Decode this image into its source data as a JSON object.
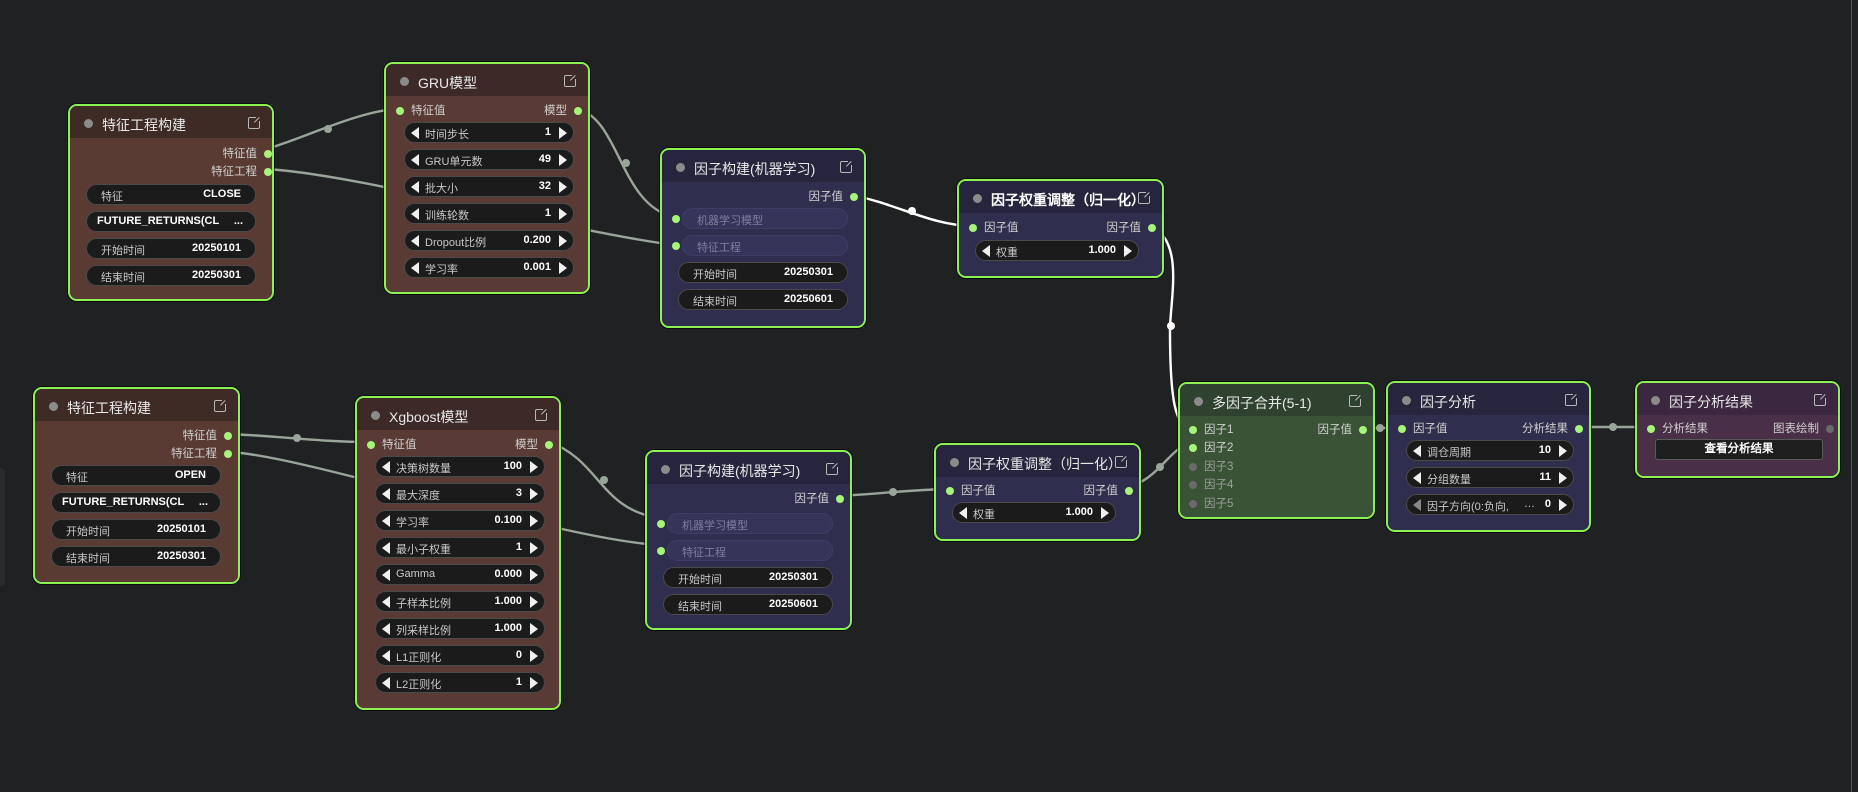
{
  "colors": {
    "canvas": "#202122",
    "node_border_active": "#8cf152",
    "feature_node_body": "#5a3b33",
    "feature_node_header": "#3f2b26",
    "model_node_body": "#5a3a35",
    "factor_node_body": "#2f2e4e",
    "factor_node_header": "#26253d",
    "merge_node_body": "#3a5336",
    "result_node_body": "#4a2f48",
    "link_color": "#9aa59a",
    "link_highlight": "#ffffff"
  },
  "nodes": {
    "feat1": {
      "title": "特征工程构建",
      "out_value": "特征值",
      "out_eng": "特征工程",
      "feature_label": "特征",
      "feature_value": "CLOSE",
      "returns_label": "FUTURE_RETURNS(CL",
      "returns_value": "...",
      "start_label": "开始时间",
      "start_value": "20250101",
      "end_label": "结束时间",
      "end_value": "20250301"
    },
    "feat2": {
      "title": "特征工程构建",
      "out_value": "特征值",
      "out_eng": "特征工程",
      "feature_label": "特征",
      "feature_value": "OPEN",
      "returns_label": "FUTURE_RETURNS(CL",
      "returns_value": "...",
      "start_label": "开始时间",
      "start_value": "20250101",
      "end_label": "结束时间",
      "end_value": "20250301"
    },
    "gru": {
      "title": "GRU模型",
      "in_value": "特征值",
      "out_model": "模型",
      "params": [
        {
          "label": "时间步长",
          "value": "1"
        },
        {
          "label": "GRU单元数",
          "value": "49"
        },
        {
          "label": "批大小",
          "value": "32"
        },
        {
          "label": "训练轮数",
          "value": "1"
        },
        {
          "label": "Dropout比例",
          "value": "0.200"
        },
        {
          "label": "学习率",
          "value": "0.001"
        }
      ]
    },
    "xgb": {
      "title": "Xgboost模型",
      "in_value": "特征值",
      "out_model": "模型",
      "params": [
        {
          "label": "决策树数量",
          "value": "100"
        },
        {
          "label": "最大深度",
          "value": "3"
        },
        {
          "label": "学习率",
          "value": "0.100"
        },
        {
          "label": "最小子权重",
          "value": "1"
        },
        {
          "label": "Gamma",
          "value": "0.000"
        },
        {
          "label": "子样本比例",
          "value": "1.000"
        },
        {
          "label": "列采样比例",
          "value": "1.000"
        },
        {
          "label": "L1正则化",
          "value": "0"
        },
        {
          "label": "L2正则化",
          "value": "1"
        }
      ]
    },
    "fb1": {
      "title": "因子构建(机器学习)",
      "out_factor": "因子值",
      "in_model": "机器学习模型",
      "in_eng": "特征工程",
      "start_label": "开始时间",
      "start_value": "20250301",
      "end_label": "结束时间",
      "end_value": "20250601"
    },
    "fb2": {
      "title": "因子构建(机器学习)",
      "out_factor": "因子值",
      "in_model": "机器学习模型",
      "in_eng": "特征工程",
      "start_label": "开始时间",
      "start_value": "20250301",
      "end_label": "结束时间",
      "end_value": "20250601"
    },
    "wa1": {
      "title": "因子权重调整（归一化）",
      "in_factor": "因子值",
      "out_factor": "因子值",
      "weight_label": "权重",
      "weight_value": "1.000"
    },
    "wa2": {
      "title": "因子权重调整（归一化）",
      "in_factor": "因子值",
      "out_factor": "因子值",
      "weight_label": "权重",
      "weight_value": "1.000"
    },
    "merge": {
      "title": "多因子合并(5-1)",
      "inputs": [
        "因子1",
        "因子2",
        "因子3",
        "因子4",
        "因子5"
      ],
      "out_factor": "因子值"
    },
    "analysis": {
      "title": "因子分析",
      "in_factor": "因子值",
      "out_result": "分析结果",
      "params": [
        {
          "label": "调仓周期",
          "value": "10"
        },
        {
          "label": "分组数量",
          "value": "11"
        },
        {
          "label": "因子方向(0:负向,",
          "value": "0"
        }
      ],
      "dir_ellipsis": "…"
    },
    "result": {
      "title": "因子分析结果",
      "in_result": "分析结果",
      "out_chart": "图表绘制",
      "button": "查看分析结果"
    }
  }
}
